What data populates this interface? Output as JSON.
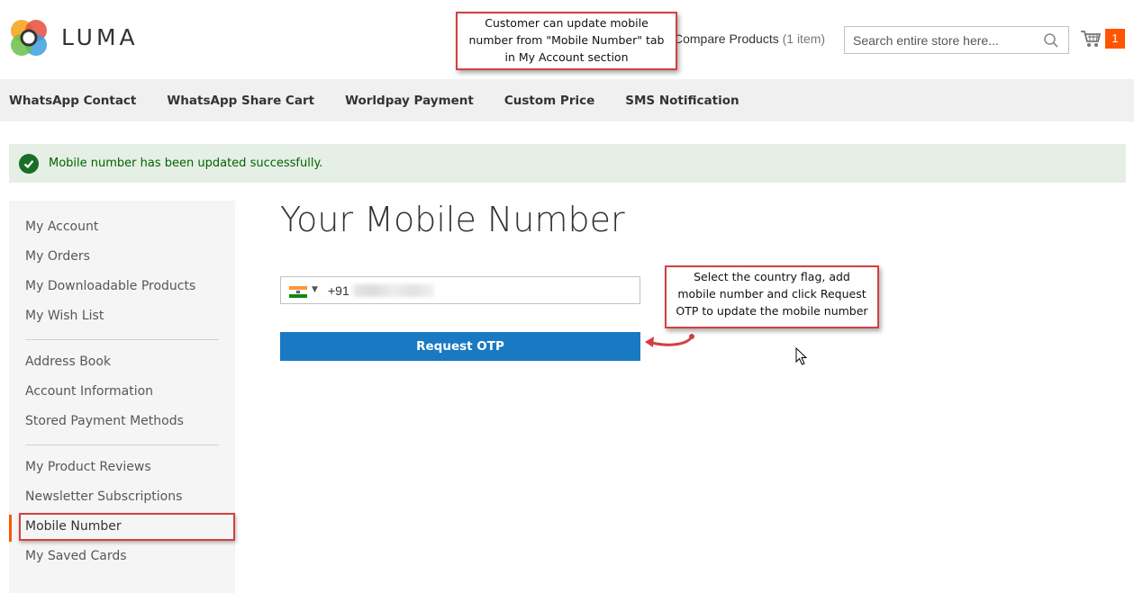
{
  "header": {
    "logo_text": "LUMA",
    "compare_label": "Compare Products",
    "compare_count": "(1 item)",
    "search_placeholder": "Search entire store here...",
    "cart_count": "1"
  },
  "callouts": {
    "top": [
      "Customer can update mobile",
      "number from \"Mobile Number\" tab",
      "in My Account section"
    ],
    "right": [
      "Select the country flag, add",
      "mobile number and click Request",
      "OTP to update the mobile number"
    ]
  },
  "nav": {
    "items": [
      "WhatsApp Contact",
      "WhatsApp Share Cart",
      "Worldpay Payment",
      "Custom Price",
      "SMS Notification"
    ]
  },
  "message": {
    "text": "Mobile number has been updated successfully."
  },
  "sidebar": {
    "items": [
      "My Account",
      "My Orders",
      "My Downloadable Products",
      "My Wish List",
      "Address Book",
      "Account Information",
      "Stored Payment Methods",
      "My Product Reviews",
      "Newsletter Subscriptions",
      "Mobile Number",
      "My Saved Cards"
    ],
    "active_index": 9
  },
  "main": {
    "title": "Your Mobile Number",
    "dial_code": "+91",
    "request_otp_label": "Request OTP"
  },
  "colors": {
    "accent_orange": "#ff5501",
    "primary_blue": "#1979c3",
    "callout_red": "#d43f3f",
    "success_green": "#006400"
  }
}
